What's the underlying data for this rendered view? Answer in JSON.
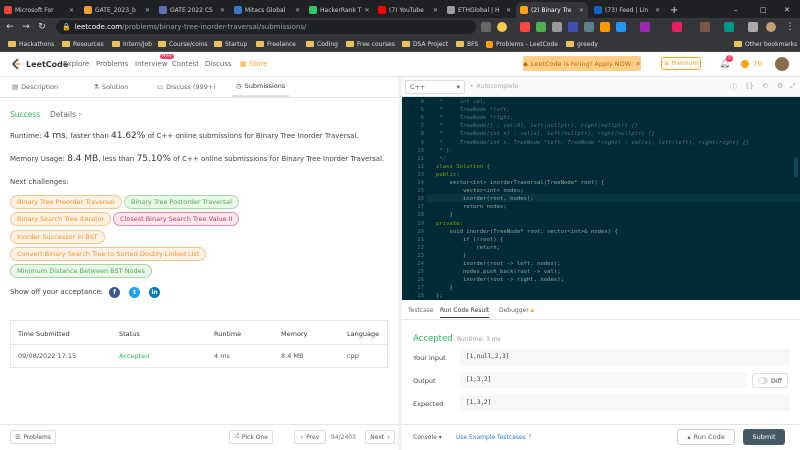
{
  "browser": {
    "tabs": [
      {
        "label": "Microsoft For",
        "color": "#e8443a"
      },
      {
        "label": "GATE_2023_b",
        "color": "#f29e38"
      },
      {
        "label": "GATE 2022 CS",
        "color": "#5f6db5"
      },
      {
        "label": "Mitacs Global",
        "color": "#3a78c8"
      },
      {
        "label": "HackerRank T",
        "color": "#2ec866"
      },
      {
        "label": "(7) YouTube",
        "color": "#ff0000"
      },
      {
        "label": "ETHGlobal | H",
        "color": "#9b9b9b"
      },
      {
        "label": "(2) Binary Tre",
        "color": "#ffa116"
      },
      {
        "label": "(73) Feed | Lin",
        "color": "#0a66c2"
      }
    ],
    "url_host": "leetcode.com",
    "url_path": "/problems/binary-tree-inorder-traversal/submissions/",
    "bookmarks": [
      "Hackathons",
      "Resources",
      "Intern/job",
      "Course/coins",
      "Startup",
      "Freelance",
      "Coding",
      "Free courses",
      "DSA Project",
      "BFS",
      "Problems - LeetCode",
      "greedy"
    ],
    "other_bookmarks": "Other bookmarks"
  },
  "header": {
    "logo": "LeetCode",
    "nav": [
      "Explore",
      "Problems",
      "Interview",
      "Contest",
      "Discuss",
      "Store"
    ],
    "new_badge": "New",
    "promo": "LeetCode is hiring! Apply NOW.",
    "premium": "Premium",
    "notif_count": "5",
    "coins": "70"
  },
  "left_tabs": [
    "Description",
    "Solution",
    "Discuss (999+)",
    "Submissions"
  ],
  "result": {
    "status": "Success",
    "details": "Details",
    "runtime_prefix": "Runtime: ",
    "runtime_value": "4 ms",
    "runtime_mid": ", faster than ",
    "runtime_pct": "41.62%",
    "runtime_suffix": " of C++ online submissions for Binary Tree Inorder Traversal.",
    "memory_prefix": "Memory Usage: ",
    "memory_value": "8.4 MB",
    "memory_mid": ", less than ",
    "memory_pct": "75.10%",
    "memory_suffix": " of C++ online submissions for Binary Tree Inorder Traversal."
  },
  "next_challenges_label": "Next challenges:",
  "challenges": [
    {
      "label": "Binary Tree Preorder Traversal",
      "difficulty": "easy"
    },
    {
      "label": "Binary Tree Postorder Traversal",
      "difficulty": "easy"
    },
    {
      "label": "Binary Search Tree Iterator",
      "difficulty": "medium"
    },
    {
      "label": "Closest Binary Search Tree Value II",
      "difficulty": "hard"
    },
    {
      "label": "Inorder Successor in BST",
      "difficulty": "medium"
    },
    {
      "label": "Convert Binary Search Tree to Sorted Doubly Linked List",
      "difficulty": "medium"
    },
    {
      "label": "Minimum Distance Between BST Nodes",
      "difficulty": "easy"
    }
  ],
  "share_label": "Show off your acceptance:",
  "submissions": {
    "headers": [
      "Time Submitted",
      "Status",
      "Runtime",
      "Memory",
      "Language"
    ],
    "rows": [
      [
        "09/08/2022 17:15",
        "Accepted",
        "4 ms",
        "8.4 MB",
        "cpp"
      ]
    ]
  },
  "footer_left": {
    "problems": "Problems",
    "pick_one": "Pick One",
    "prev": "Prev",
    "page": "94/2403",
    "next": "Next"
  },
  "editor": {
    "language": "C++",
    "autocomplete": "Autocomplete",
    "lines": [
      {
        "n": "4",
        "t": " *     int val;"
      },
      {
        "n": "5",
        "t": " *     TreeNode *left;"
      },
      {
        "n": "6",
        "t": " *     TreeNode *right;"
      },
      {
        "n": "7",
        "t": " *     TreeNode() : val(0), left(nullptr), right(nullptr) {}"
      },
      {
        "n": "8",
        "t": " *     TreeNode(int x) : val(x), left(nullptr), right(nullptr) {}"
      },
      {
        "n": "9",
        "t": " *     TreeNode(int x, TreeNode *left, TreeNode *right) : val(x), left(left), right(right) {}"
      },
      {
        "n": "10",
        "t": " * };"
      },
      {
        "n": "11",
        "t": " */"
      },
      {
        "n": "12",
        "t": "class Solution {"
      },
      {
        "n": "13",
        "t": "public:"
      },
      {
        "n": "14",
        "t": "    vector<int> inorderTraversal(TreeNode* root) {"
      },
      {
        "n": "15",
        "t": "        vector<int> nodes;"
      },
      {
        "n": "16",
        "t": "        inorder(root, nodes);"
      },
      {
        "n": "17",
        "t": "        return nodes;"
      },
      {
        "n": "18",
        "t": "    }"
      },
      {
        "n": "19",
        "t": "private:"
      },
      {
        "n": "20",
        "t": "    void inorder(TreeNode* root, vector<int>& nodes) {"
      },
      {
        "n": "21",
        "t": "        if (!root) {"
      },
      {
        "n": "22",
        "t": "            return;"
      },
      {
        "n": "23",
        "t": "        }"
      },
      {
        "n": "24",
        "t": "        inorder(root -> left, nodes);"
      },
      {
        "n": "25",
        "t": "        nodes.push_back(root -> val);"
      },
      {
        "n": "26",
        "t": "        inorder(root -> right, nodes);"
      },
      {
        "n": "27",
        "t": "    }"
      },
      {
        "n": "28",
        "t": "};"
      }
    ]
  },
  "result_panel": {
    "tabs": [
      "Testcase",
      "Run Code Result",
      "Debugger"
    ],
    "status": "Accepted",
    "runtime": "Runtime: 3 ms",
    "input_label": "Your input",
    "input_value": "[1,null,2,3]",
    "output_label": "Output",
    "output_value": "[1,3,2]",
    "expected_label": "Expected",
    "expected_value": "[1,3,2]",
    "diff": "Diff",
    "console": "Console",
    "use_example": "Use Example Testcases",
    "run_code": "Run Code",
    "submit": "Submit"
  }
}
